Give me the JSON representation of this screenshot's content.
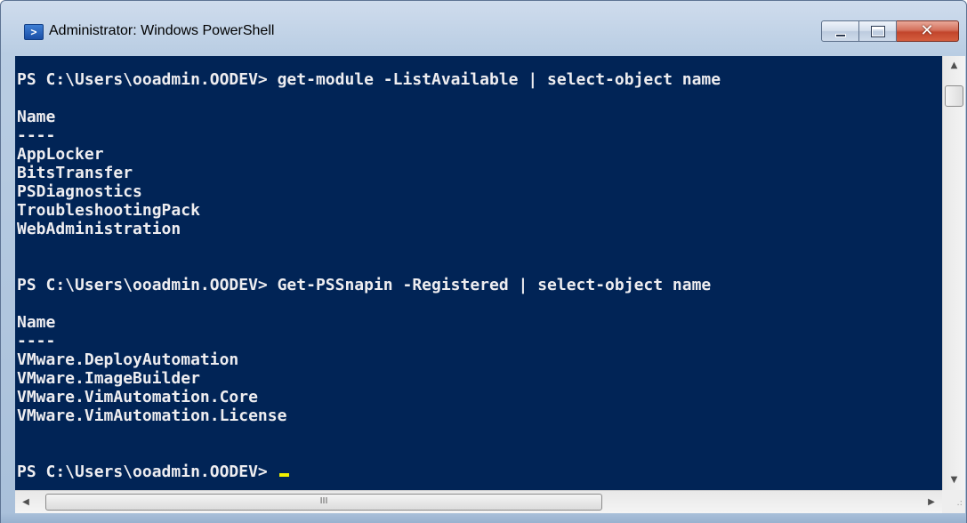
{
  "window": {
    "title": "Administrator: Windows PowerShell",
    "icon": "powershell-icon",
    "buttons": {
      "minimize": "minimize-icon",
      "maximize": "maximize-icon",
      "close": "close-icon",
      "close_glyph": "✕"
    }
  },
  "console": {
    "background": "#012456",
    "foreground": "#eeedf0",
    "cursor_color": "#f0f000",
    "lines": [
      "PS C:\\Users\\ooadmin.OODEV> get-module -ListAvailable | select-object name",
      "",
      "Name",
      "----",
      "AppLocker",
      "BitsTransfer",
      "PSDiagnostics",
      "TroubleshootingPack",
      "WebAdministration",
      "",
      "",
      "PS C:\\Users\\ooadmin.OODEV> Get-PSSnapin -Registered | select-object name",
      "",
      "Name",
      "----",
      "VMware.DeployAutomation",
      "VMware.ImageBuilder",
      "VMware.VimAutomation.Core",
      "VMware.VimAutomation.License",
      "",
      "",
      "PS C:\\Users\\ooadmin.OODEV> "
    ]
  },
  "scrollbars": {
    "vertical": {
      "up_arrow": "▲",
      "down_arrow": "▼"
    },
    "horizontal": {
      "left_arrow": "◀",
      "right_arrow": "▶",
      "thumb_grip": "III"
    },
    "size_grip": ".:"
  }
}
